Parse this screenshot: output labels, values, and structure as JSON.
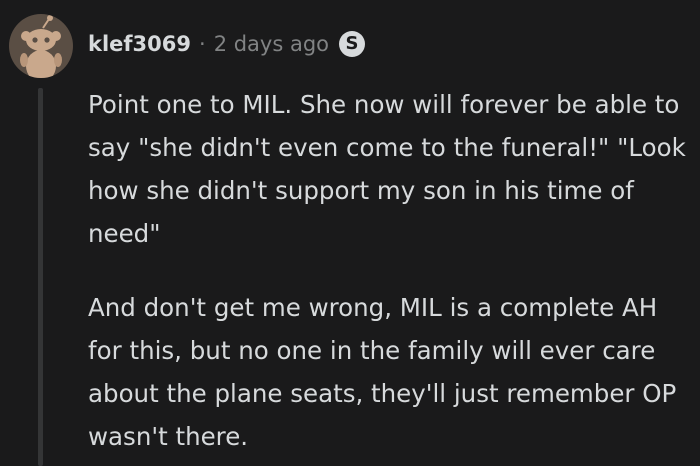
{
  "comment": {
    "author": "klef3069",
    "separator": "·",
    "timestamp": "2 days ago",
    "badge": "S",
    "badge_icon": "snoo-badge-icon",
    "avatar_icon": "snoo-avatar-icon",
    "paragraphs": [
      "Point one to MIL. She now will forever be able to say \"she didn't even come to the funeral!\" \"Look how she didn't support my son in his time of need\"",
      "And don't get me wrong, MIL is a complete AH for this, but no one in the family will ever care about the plane seats, they'll just remember OP wasn't there."
    ]
  },
  "colors": {
    "background": "#1a1a1b",
    "text": "#d7dadc",
    "muted": "#818384",
    "avatar_bg": "#5a4e44",
    "thread_line": "#343536"
  }
}
